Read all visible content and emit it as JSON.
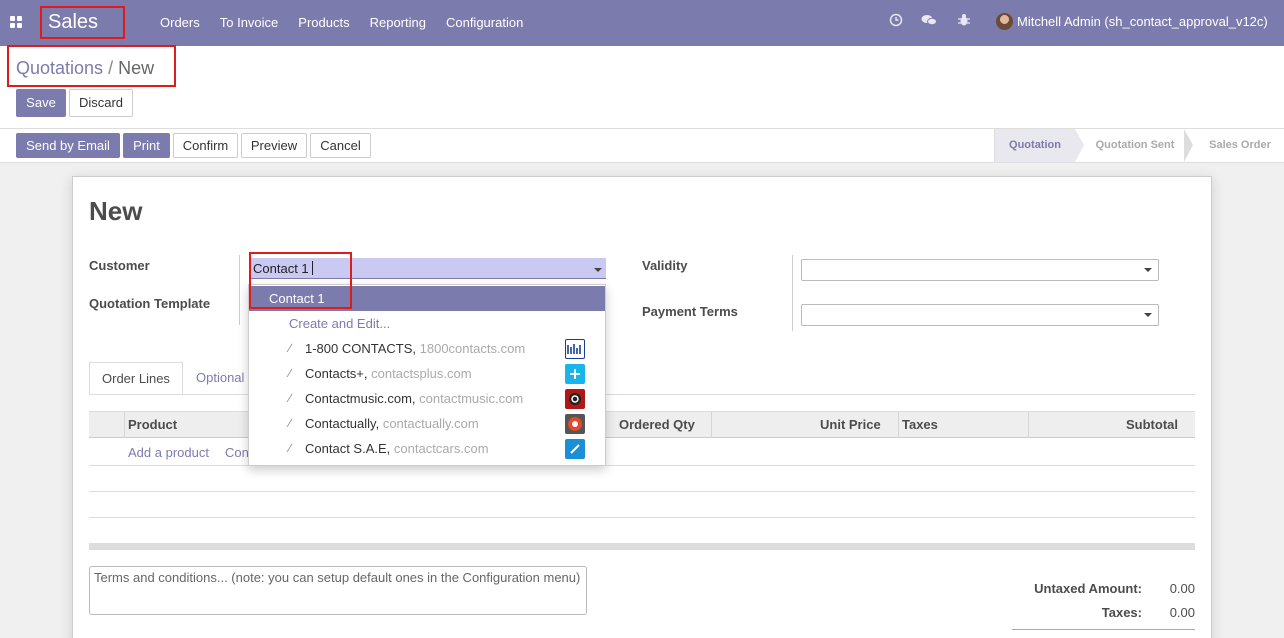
{
  "navbar": {
    "brand": "Sales",
    "menu": [
      "Orders",
      "To Invoice",
      "Products",
      "Reporting",
      "Configuration"
    ],
    "user": "Mitchell Admin (sh_contact_approval_v12c)",
    "icons": [
      "apps-icon",
      "clock-icon",
      "chat-icon",
      "bug-icon"
    ]
  },
  "breadcrumb": {
    "parent": "Quotations",
    "separator": "/",
    "current": "New"
  },
  "control": {
    "save": "Save",
    "discard": "Discard"
  },
  "header_buttons": {
    "send_email": "Send by Email",
    "print": "Print",
    "confirm": "Confirm",
    "preview": "Preview",
    "cancel": "Cancel"
  },
  "statusbar": [
    "Quotation",
    "Quotation Sent",
    "Sales Order"
  ],
  "form": {
    "title": "New",
    "customer_label": "Customer",
    "customer_value": "Contact 1",
    "template_label": "Quotation Template",
    "validity_label": "Validity",
    "payment_terms_label": "Payment Terms"
  },
  "dropdown": {
    "selected": "Contact 1",
    "create_edit": "Create and Edit...",
    "suggestions": [
      {
        "name": "1-800 CONTACTS,",
        "domain": "1800contacts.com",
        "logo_color": "#1b3f8f"
      },
      {
        "name": "Contacts+,",
        "domain": "contactsplus.com",
        "logo_color": "#19b5e8"
      },
      {
        "name": "Contactmusic.com,",
        "domain": "contactmusic.com",
        "logo_color": "#b01818"
      },
      {
        "name": "Contactually,",
        "domain": "contactually.com",
        "logo_color": "#e8472b"
      },
      {
        "name": "Contact S.A.E,",
        "domain": "contactcars.com",
        "logo_color": "#1a8fd8"
      }
    ]
  },
  "tabs": [
    "Order Lines",
    "Optional"
  ],
  "table": {
    "columns": [
      "Product",
      "Ordered Qty",
      "Unit Price",
      "Taxes",
      "Subtotal"
    ],
    "add_product": "Add a product",
    "add_section_partial": "Con"
  },
  "terms_placeholder": "Terms and conditions... (note: you can setup default ones in the Configuration menu)",
  "totals": {
    "untaxed_label": "Untaxed Amount:",
    "untaxed_value": "0.00",
    "taxes_label": "Taxes:",
    "taxes_value": "0.00"
  },
  "colors": {
    "brand": "#7c7bad",
    "highlight": "#e01b1b"
  }
}
